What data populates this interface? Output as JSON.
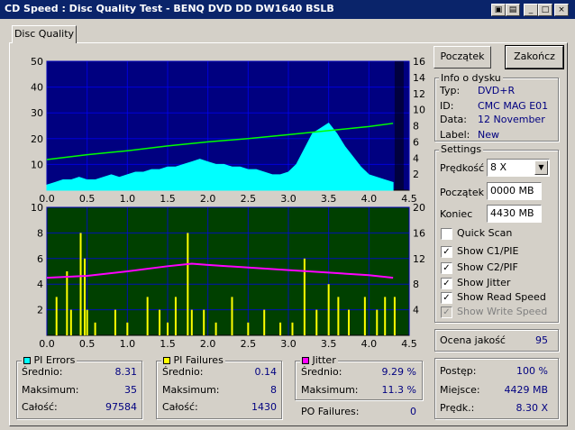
{
  "window": {
    "title": "CD Speed : Disc Quality Test - BENQ    DVD DD DW1640    BSLB",
    "controls": [
      "▣",
      "▤",
      "_",
      "□",
      "×"
    ]
  },
  "tab": {
    "label": "Disc Quality"
  },
  "buttons": {
    "start": "Początek",
    "end": "Zakończ"
  },
  "disc_info": {
    "title": "Info o dysku",
    "rows": [
      {
        "label": "Typ:",
        "value": "DVD+R"
      },
      {
        "label": "ID:",
        "value": "CMC MAG E01"
      },
      {
        "label": "Data:",
        "value": "12 November"
      },
      {
        "label": "Label:",
        "value": "New"
      }
    ]
  },
  "settings": {
    "title": "Settings",
    "speed_label": "Prędkość",
    "speed_value": "8 X",
    "start_label": "Początek",
    "start_value": "0000 MB",
    "end_label": "Koniec",
    "end_value": "4430 MB",
    "checks": [
      {
        "label": "Quick Scan",
        "checked": false,
        "disabled": false
      },
      {
        "label": "Show C1/PIE",
        "checked": true,
        "disabled": false
      },
      {
        "label": "Show C2/PIF",
        "checked": true,
        "disabled": false
      },
      {
        "label": "Show Jitter",
        "checked": true,
        "disabled": false
      },
      {
        "label": "Show Read Speed",
        "checked": true,
        "disabled": false
      },
      {
        "label": "Show Write Speed",
        "checked": true,
        "disabled": true
      }
    ]
  },
  "quality": {
    "label": "Ocena jakość",
    "value": "95"
  },
  "progress": {
    "rows": [
      {
        "label": "Postęp:",
        "value": "100 %"
      },
      {
        "label": "Miejsce:",
        "value": "4429 MB"
      },
      {
        "label": "Prędk.:",
        "value": "8.30 X"
      }
    ]
  },
  "pi_errors": {
    "title": "PI Errors",
    "color": "#00ffff",
    "rows": [
      {
        "label": "Średnio:",
        "value": "8.31"
      },
      {
        "label": "Maksimum:",
        "value": "35"
      },
      {
        "label": "Całość:",
        "value": "97584"
      }
    ]
  },
  "pi_failures": {
    "title": "PI Failures",
    "color": "#ffff00",
    "rows": [
      {
        "label": "Średnio:",
        "value": "0.14"
      },
      {
        "label": "Maksimum:",
        "value": "8"
      },
      {
        "label": "Całość:",
        "value": "1430"
      }
    ]
  },
  "jitter": {
    "title": "Jitter",
    "color": "#ff00ff",
    "rows": [
      {
        "label": "Średnio:",
        "value": "9.29 %"
      },
      {
        "label": "Maksimum:",
        "value": "11.3 %"
      }
    ]
  },
  "po_failures": {
    "label": "PO Failures:",
    "value": "0"
  },
  "chart_data": [
    {
      "type": "area",
      "xlim": [
        0,
        4.5
      ],
      "ylim_left": [
        0,
        50
      ],
      "ylim_right": [
        0,
        16
      ],
      "x_ticks": [
        "0.0",
        "0.5",
        "1.0",
        "1.5",
        "2.0",
        "2.5",
        "3.0",
        "3.5",
        "4.0",
        "4.5"
      ],
      "y_ticks_left": [
        "10",
        "20",
        "30",
        "40",
        "50"
      ],
      "y_ticks_right": [
        "2",
        "4",
        "6",
        "8",
        "10",
        "12",
        "14",
        "16"
      ],
      "background": "#000080",
      "grid": true,
      "series": [
        {
          "color": "#00ffff",
          "x": [
            0.0,
            0.1,
            0.2,
            0.3,
            0.4,
            0.5,
            0.6,
            0.7,
            0.8,
            0.9,
            1.0,
            1.1,
            1.2,
            1.3,
            1.4,
            1.5,
            1.6,
            1.7,
            1.8,
            1.9,
            2.0,
            2.1,
            2.2,
            2.3,
            2.4,
            2.5,
            2.6,
            2.7,
            2.8,
            2.9,
            3.0,
            3.1,
            3.2,
            3.3,
            3.4,
            3.5,
            3.6,
            3.7,
            3.8,
            3.9,
            4.0,
            4.1,
            4.2,
            4.3
          ],
          "y": [
            2,
            3,
            4,
            4,
            5,
            4,
            4,
            5,
            6,
            5,
            6,
            7,
            7,
            8,
            8,
            9,
            9,
            10,
            11,
            12,
            11,
            10,
            10,
            9,
            9,
            8,
            8,
            7,
            6,
            6,
            7,
            10,
            16,
            22,
            24,
            26,
            22,
            17,
            13,
            9,
            6,
            5,
            4,
            3
          ]
        },
        {
          "color": "#00ff00",
          "x": [
            0.0,
            0.5,
            1.0,
            1.5,
            2.0,
            2.5,
            3.0,
            3.5,
            4.0,
            4.3
          ],
          "y": [
            3.8,
            4.4,
            4.9,
            5.5,
            6.0,
            6.4,
            6.9,
            7.4,
            7.9,
            8.3
          ]
        }
      ]
    },
    {
      "type": "bar",
      "xlim": [
        0,
        4.5
      ],
      "ylim_left": [
        0,
        10
      ],
      "ylim_right": [
        0,
        20
      ],
      "x_ticks": [
        "0.0",
        "0.5",
        "1.0",
        "1.5",
        "2.0",
        "2.5",
        "3.0",
        "3.5",
        "4.0",
        "4.5"
      ],
      "y_ticks_left": [
        "2",
        "4",
        "6",
        "8",
        "10"
      ],
      "y_ticks_right": [
        "4",
        "8",
        "12",
        "16",
        "20"
      ],
      "background": "#004000",
      "grid": true,
      "series": [
        {
          "color": "#ffff00",
          "x": [
            0.12,
            0.25,
            0.3,
            0.42,
            0.47,
            0.5,
            0.6,
            0.85,
            1.0,
            1.25,
            1.4,
            1.5,
            1.6,
            1.75,
            1.8,
            1.95,
            2.1,
            2.3,
            2.5,
            2.7,
            2.9,
            3.05,
            3.2,
            3.35,
            3.5,
            3.62,
            3.75,
            3.95,
            4.1,
            4.2,
            4.32
          ],
          "y": [
            3,
            5,
            2,
            8,
            6,
            2,
            1,
            2,
            1,
            3,
            2,
            1,
            3,
            8,
            2,
            2,
            1,
            3,
            1,
            2,
            1,
            1,
            6,
            2,
            4,
            3,
            2,
            3,
            2,
            3,
            3
          ]
        },
        {
          "color": "#ff00ff",
          "x": [
            0.0,
            0.5,
            1.0,
            1.5,
            1.8,
            2.0,
            2.5,
            3.0,
            3.5,
            4.0,
            4.3
          ],
          "y": [
            9.0,
            9.3,
            10.0,
            10.8,
            11.2,
            11.0,
            10.6,
            10.2,
            9.8,
            9.4,
            9.0
          ]
        }
      ]
    }
  ]
}
